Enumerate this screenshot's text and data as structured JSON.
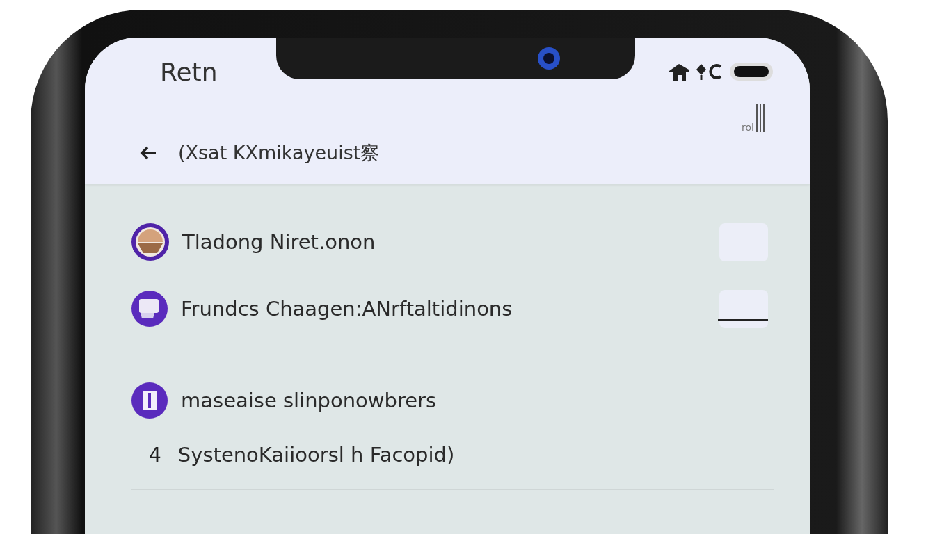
{
  "status_bar": {
    "title": "Retn"
  },
  "toolbar": {
    "indicator": "rol"
  },
  "header": {
    "title": "(Xsat KXmikayeuist察"
  },
  "items": [
    {
      "kind": "avatar",
      "label": "Tladong Niret.onon",
      "trailing": {
        "kind": "plain"
      }
    },
    {
      "kind": "device",
      "label": "Frundcs  Chaagen:ANrftaltidinons",
      "trailing": {
        "kind": "underlined"
      }
    },
    {
      "kind": "badge",
      "label": "maseaise slinponowbrers"
    },
    {
      "kind": "numbered",
      "number": "4",
      "label": "SystenoKaiioorsl  h Facopid)"
    }
  ]
}
